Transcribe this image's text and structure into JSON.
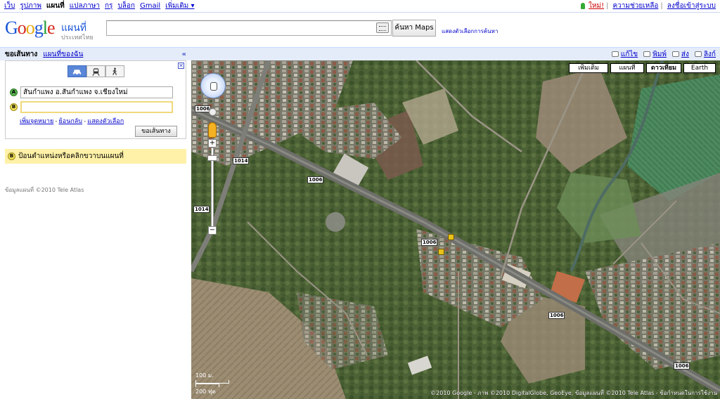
{
  "topnav": {
    "items": [
      "เว็บ",
      "รูปภาพ",
      "แผนที่",
      "แปลภาษา",
      "กรุ",
      "บล็อก",
      "Gmail",
      "เพิ่มเติม ▾"
    ],
    "active_index": 2,
    "new_label": "ใหม่!",
    "help_label": "ความช่วยเหลือ",
    "signin_label": "ลงชื่อเข้าสู่ระบบ",
    "separator": "|"
  },
  "header": {
    "logo_letters": [
      "G",
      "o",
      "o",
      "g",
      "l",
      "e"
    ],
    "logo_sub": "แผนที่",
    "logo_country": "ประเทศไทย",
    "search_value": "",
    "search_button": "ค้นหา Maps",
    "search_options": "แสดงตัวเลือกการค้นหา"
  },
  "panel": {
    "tab_directions": "ขอเส้นทาง",
    "tab_mymaps": "แผนที่ของฉัน",
    "collapse_glyph": "«",
    "close_glyph": "✕",
    "waypoint_a_marker": "A",
    "waypoint_a_value": "สันกำแพง อ.สันกำแพง จ.เชียงใหม่",
    "waypoint_b_marker": "B",
    "waypoint_b_value": "",
    "link_add_dest": "เพิ่มจุดหมาย",
    "link_reverse": "ย้อนกลับ",
    "link_options": "แสดงตัวเลือก",
    "link_dash": "-",
    "get_directions": "ขอเส้นทาง",
    "hint_marker": "B",
    "hint_text": "ป้อนตำแหน่งหรือคลิกขวาบนแผนที่",
    "map_data": "ข้อมูลแผนที่ ©2010 Tele Atlas"
  },
  "maphead": {
    "edit": "แก้ไข",
    "print": "พิมพ์",
    "send": "ส่ง",
    "link": "ลิงก์"
  },
  "map": {
    "types": [
      "เพิ่มเติม",
      "แผนที่",
      "ดาวเทียม",
      "Earth"
    ],
    "selected_type_index": 2,
    "road_labels": [
      "1006",
      "1014",
      "1006",
      "1014",
      "1006",
      "1006",
      "1006"
    ],
    "zoom_in": "+",
    "zoom_out": "−",
    "scale_metric": "100 ม.",
    "scale_imperial": "200 ฟุต",
    "copyright": "©2010 Google - ภาพ ©2010 DigitalGlobe, GeoEye, ข้อมูลแผนที่ ©2010 Tele Atlas - ข้อกำหนดในการใช้งาน"
  }
}
